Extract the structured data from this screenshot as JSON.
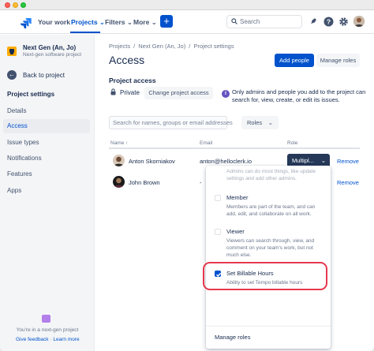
{
  "topnav": {
    "items": [
      "Your work",
      "Projects",
      "Filters",
      "More"
    ],
    "create_label": "+",
    "search_placeholder": "Search"
  },
  "sidebar": {
    "project_name": "Next Gen (An, Jo)",
    "project_type": "Next-gen software project",
    "back_label": "Back to project",
    "section_title": "Project settings",
    "items": [
      "Details",
      "Access",
      "Issue types",
      "Notifications",
      "Features",
      "Apps"
    ],
    "active_item": "Access",
    "footer_text": "You're in a next-gen project",
    "footer_link_1": "Give feedback",
    "footer_link_2": "Learn more"
  },
  "main": {
    "breadcrumbs": [
      "Projects",
      "Next Gen (An, Jo)",
      "Project settings"
    ],
    "title": "Access",
    "add_people": "Add people",
    "manage_roles": "Manage roles",
    "project_access_title": "Project access",
    "access_level": "Private",
    "change_access": "Change project access",
    "info_text": "Only admins and people you add to the project can search for, view, create, or edit its issues.",
    "filter_placeholder": "Search for names, groups or email addresses",
    "roles_filter": "Roles",
    "columns": {
      "name": "Name",
      "email": "Email",
      "role": "Role"
    },
    "rows": [
      {
        "name": "Anton Skorniakov",
        "email": "anton@helloclerk.io",
        "role": "Multipl...",
        "action": "Remove"
      },
      {
        "name": "John Brown",
        "email": "-",
        "role": "",
        "action": "Remove"
      }
    ]
  },
  "role_dropdown": {
    "faded_desc": "Admins can do most things, like update settings and add other admins.",
    "options": [
      {
        "title": "Member",
        "desc": "Members are part of the team, and can add, edit, and collaborate on all work.",
        "checked": false
      },
      {
        "title": "Viewer",
        "desc": "Viewers can search through, view, and comment on your team's work, but not much else.",
        "checked": false
      },
      {
        "title": "Set Billable Hours",
        "desc": "Ability to set Tempo billable hours",
        "checked": true
      }
    ],
    "manage_roles": "Manage roles"
  },
  "colors": {
    "brand": "#0052cc",
    "highlight": "#e5384e",
    "dark_button": "#253858"
  }
}
